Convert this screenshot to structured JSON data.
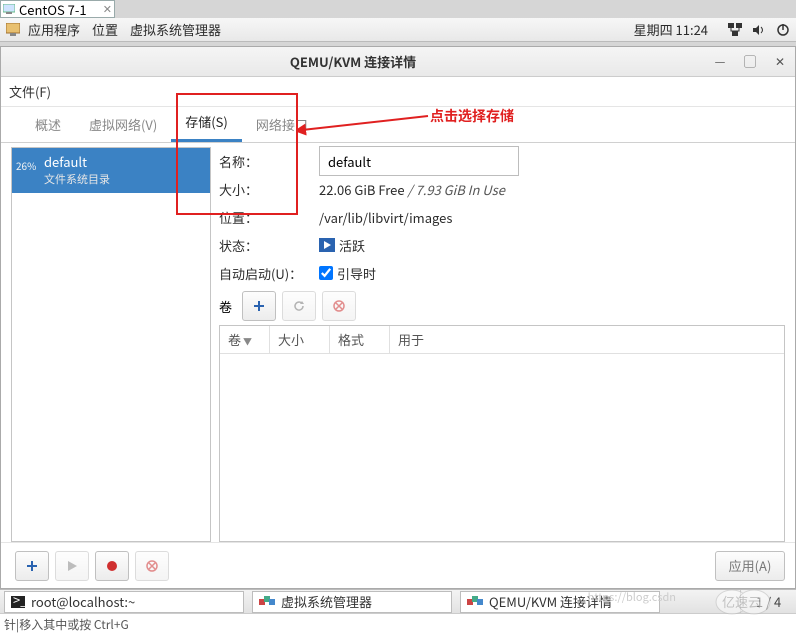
{
  "vm_tab": {
    "label": "CentOS 7-1"
  },
  "gnome": {
    "apps": "应用程序",
    "places": "位置",
    "vmm": "虚拟系统管理器",
    "clock": "星期四 11:24"
  },
  "window": {
    "title": "QEMU/KVM 连接详情",
    "menu_file": "文件(F)",
    "tabs": {
      "overview": "概述",
      "vnet": "虚拟网络(V)",
      "storage": "存储(S)",
      "iface": "网络接口"
    },
    "pool": {
      "percent": "26%",
      "name": "default",
      "subtitle": "文件系统目录"
    },
    "fields": {
      "name_label": "名称：",
      "name_value": "default",
      "size_label": "大小：",
      "size_value_free": "22.06 GiB Free",
      "size_value_sep": " / ",
      "size_value_used": "7.93 GiB In Use",
      "location_label": "位置：",
      "location_value": "/var/lib/libvirt/images",
      "state_label": "状态：",
      "state_value": "活跃",
      "autostart_label": "自动启动(U)：",
      "autostart_value": "引导时",
      "volumes_label": "卷"
    },
    "grid": {
      "col_volume": "卷",
      "col_size": "大小",
      "col_format": "格式",
      "col_used": "用于"
    },
    "apply": "应用(A)"
  },
  "annotation": "点击选择存储",
  "taskbar": {
    "term": "root@localhost:~",
    "vmm": "虚拟系统管理器",
    "conn": "QEMU/KVM 连接详情",
    "ws": "1 / 4"
  },
  "hint": "针|移入其中或按 Ctrl+G",
  "watermark_text": "https://blog.csdn"
}
